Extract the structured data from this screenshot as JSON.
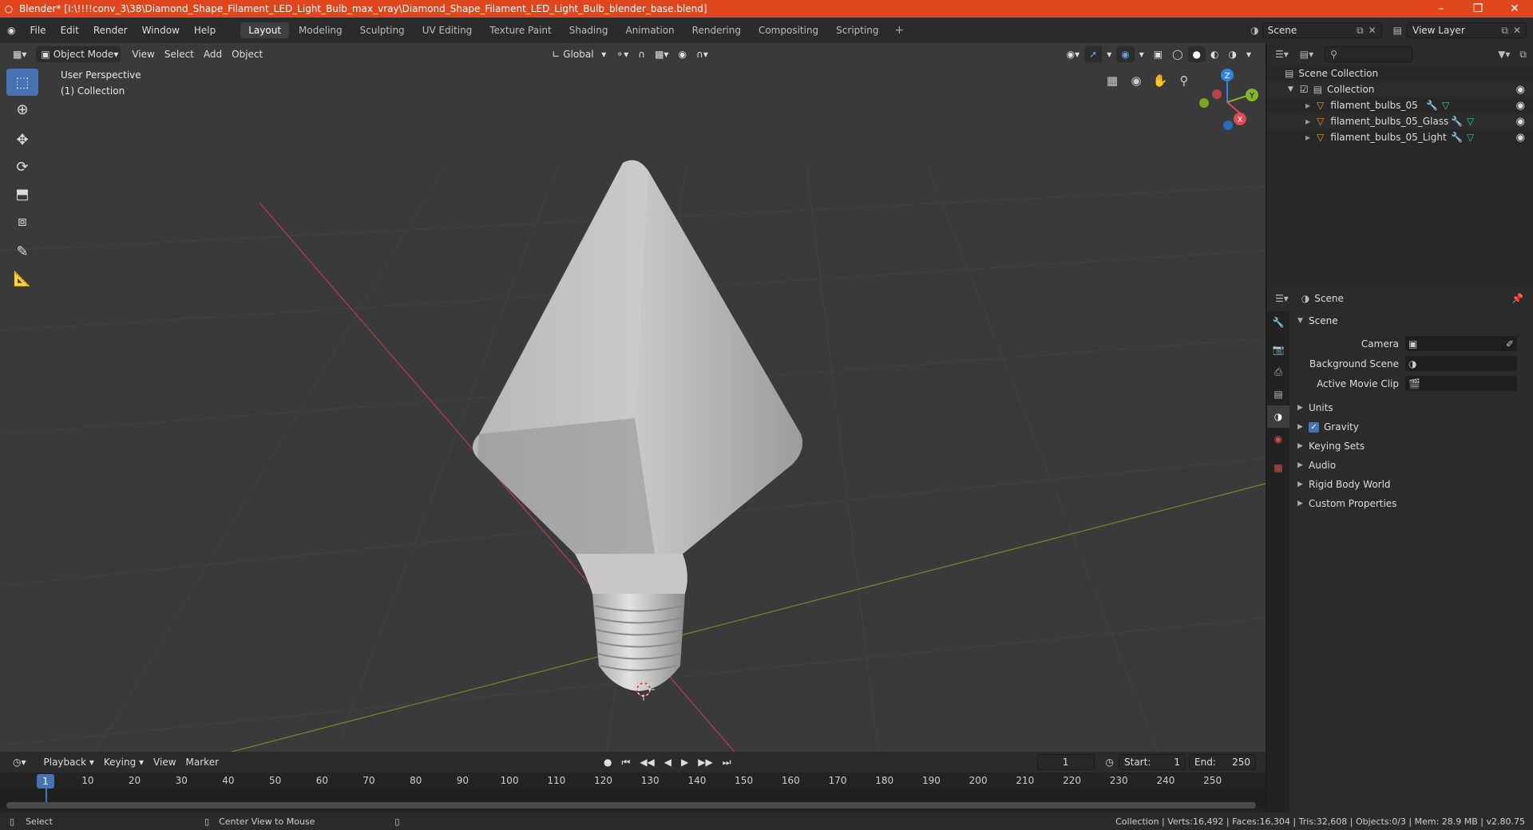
{
  "window": {
    "title": "Blender* [I:\\!!!!conv_3\\38\\Diamond_Shape_Filament_LED_Light_Bulb_max_vray\\Diamond_Shape_Filament_LED_Light_Bulb_blender_base.blend]",
    "minimize": "–",
    "maximize": "❐",
    "close": "✕"
  },
  "menu": [
    "File",
    "Edit",
    "Render",
    "Window",
    "Help"
  ],
  "workspaces": [
    "Layout",
    "Modeling",
    "Sculpting",
    "UV Editing",
    "Texture Paint",
    "Shading",
    "Animation",
    "Rendering",
    "Compositing",
    "Scripting"
  ],
  "active_workspace": "Layout",
  "scene_field": "Scene",
  "view_layer_field": "View Layer",
  "viewport": {
    "mode": "Object Mode",
    "menus": [
      "View",
      "Select",
      "Add",
      "Object"
    ],
    "orientation": "Global",
    "info_line1": "User Perspective",
    "info_line2": "(1) Collection",
    "gizmo": {
      "z": "Z",
      "y": "Y",
      "x": "X"
    }
  },
  "timeline": {
    "menus": [
      "Playback",
      "Keying",
      "View",
      "Marker"
    ],
    "current_frame": "1",
    "start_label": "Start:",
    "start": "1",
    "end_label": "End:",
    "end": "250",
    "ticks": [
      "1",
      "10",
      "20",
      "30",
      "40",
      "50",
      "60",
      "70",
      "80",
      "90",
      "100",
      "110",
      "120",
      "130",
      "140",
      "150",
      "160",
      "170",
      "180",
      "190",
      "200",
      "210",
      "220",
      "230",
      "240",
      "250"
    ]
  },
  "status": {
    "select": "Select",
    "center_view": "Center View to Mouse",
    "stats": "Collection | Verts:16,492 | Faces:16,304 | Tris:32,608 | Objects:0/3 | Mem: 28.9 MB | v2.80.75"
  },
  "outliner": {
    "scene_collection": "Scene Collection",
    "collection": "Collection",
    "objects": [
      "filament_bulbs_05",
      "filament_bulbs_05_Glass",
      "filament_bulbs_05_Light"
    ]
  },
  "properties": {
    "header": "Scene",
    "panel": "Scene",
    "camera_label": "Camera",
    "background_scene_label": "Background Scene",
    "active_movie_clip_label": "Active Movie Clip",
    "subpanels": [
      "Units",
      "Gravity",
      "Keying Sets",
      "Audio",
      "Rigid Body World",
      "Custom Properties"
    ],
    "gravity_checked": true
  },
  "colors": {
    "titlebar": "#e0461e",
    "accent": "#4772b3",
    "x_axis": "#e04a52",
    "y_axis": "#86b32b",
    "z_axis": "#2f85e0"
  }
}
